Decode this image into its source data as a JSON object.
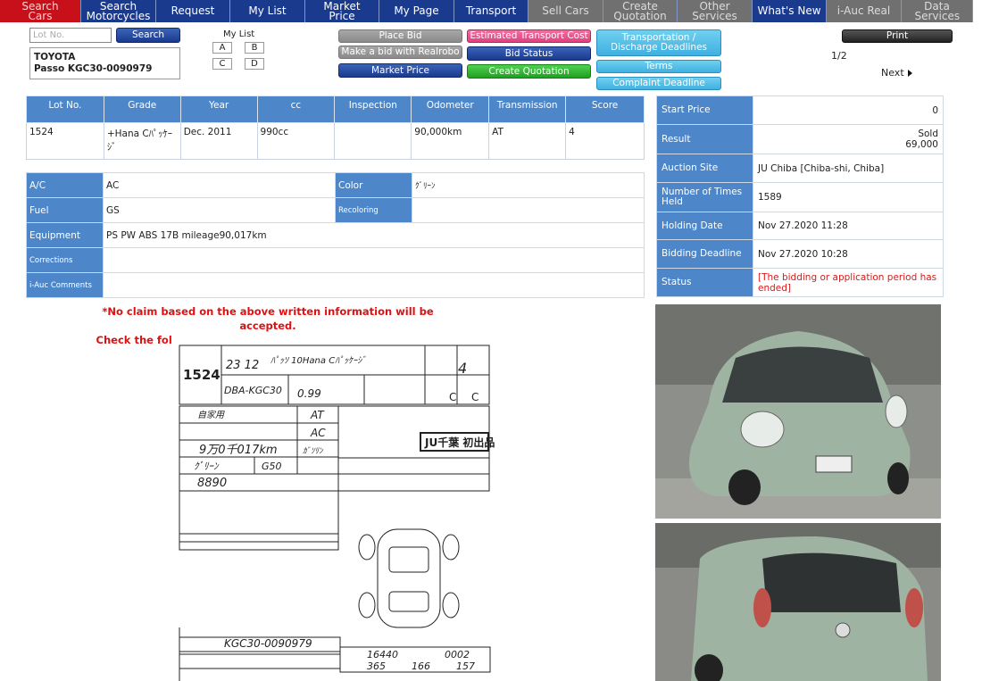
{
  "nav": {
    "items": [
      {
        "label": "Search Cars",
        "style": "active"
      },
      {
        "label": "Search Motorcycles",
        "style": "normal"
      },
      {
        "label": "Request",
        "style": "normal"
      },
      {
        "label": "My List",
        "style": "normal"
      },
      {
        "label": "Market Price",
        "style": "normal"
      },
      {
        "label": "My Page",
        "style": "normal"
      },
      {
        "label": "Transport",
        "style": "normal"
      },
      {
        "label": "Sell Cars",
        "style": "gray"
      },
      {
        "label": "Create Quotation",
        "style": "gray"
      },
      {
        "label": "Other Services",
        "style": "gray"
      },
      {
        "label": "What's New",
        "style": "normal"
      },
      {
        "label": "i-Auc Real",
        "style": "gray"
      },
      {
        "label": "Data Services",
        "style": "gray"
      }
    ]
  },
  "toolbar": {
    "lot_placeholder": "Lot No.",
    "search_label": "Search",
    "mylist_label": "My List",
    "mylist_slots": [
      "A",
      "B",
      "C",
      "D"
    ],
    "place_bid": "Place Bid",
    "make_bid_realrobo": "Make a bid with Realrobo",
    "market_price": "Market Price",
    "estimated_transport": "Estimated Transport Cost",
    "bid_status": "Bid Status",
    "create_quotation": "Create Quotation",
    "transport_deadlines": "Transportation / Discharge Deadlines",
    "terms": "Terms",
    "complaint_deadline": "Complaint Deadline",
    "print": "Print",
    "page_count": "1/2",
    "next": "Next"
  },
  "vehicle": {
    "make": "TOYOTA",
    "model": "Passo KGC30-0090979"
  },
  "spec_table": {
    "headers": [
      "Lot No.",
      "Grade",
      "Year",
      "cc",
      "Inspection",
      "Odometer",
      "Transmission",
      "Score"
    ],
    "row": [
      "1524",
      "+Hana Cﾊﾟｯｹｰｼﾞ",
      "Dec. 2011",
      "990cc",
      "",
      "90,000km",
      "AT",
      "4"
    ]
  },
  "details": {
    "ac_label": "A/C",
    "ac_value": "AC",
    "color_label": "Color",
    "color_value": "ｸﾞﾘｰﾝ",
    "fuel_label": "Fuel",
    "fuel_value": "GS",
    "recoloring_label": "Recoloring",
    "recoloring_value": "",
    "equipment_label": "Equipment",
    "equipment_value": "PS PW ABS 17B  mileage90,017km",
    "corrections_label": "Corrections",
    "corrections_value": "",
    "comments_label": "i-Auc Comments",
    "comments_value": ""
  },
  "auction_info": {
    "start_price_label": "Start Price",
    "start_price": "0",
    "result_label": "Result",
    "result_status": "Sold",
    "result_price": "69,000",
    "site_label": "Auction Site",
    "site": "JU Chiba [Chiba-shi, Chiba]",
    "times_label": "Number of Times Held",
    "times": "1589",
    "holding_label": "Holding Date",
    "holding": "Nov 27.2020 11:28",
    "deadline_label": "Bidding Deadline",
    "deadline": "Nov 27.2020 10:28",
    "status_label": "Status",
    "status": "[The bidding or application period has ended]"
  },
  "warning": {
    "line1": "*No claim based on the above written information will be accepted.",
    "line2": "Check the following auction sheet carefully before bidding."
  },
  "sheet": {
    "lot": "1524",
    "year_handwritten": "23 12",
    "model_handwritten": "ﾊﾟｯｿ 10Hana Cﾊﾟｯｹｰｼﾞ",
    "type_handwritten": "DBA-KGC30",
    "cc_handwritten": "0.99",
    "score_handwritten": "4",
    "interior": "C",
    "exterior": "C",
    "shift": "AT",
    "ac": "AC",
    "fuel": "ｶﾞｿﾘﾝ",
    "mileage_handwritten": "9万0千017km",
    "color_handwritten": "ｸﾞﾘｰﾝ",
    "color_code": "G50",
    "number": "8890",
    "usage": "自家用",
    "stamp": "JU千葉 初出品",
    "chassis": "KGC30-0090979",
    "codes": "16440",
    "code2": "0002",
    "dim1": "365",
    "dim2": "166",
    "dim3": "157"
  },
  "colors": {
    "nav_blue": "#1a3a8e",
    "nav_red": "#c8101a",
    "header_blue": "#4e87c9",
    "warning_red": "#e01010",
    "car_green": "#9fb3a3"
  }
}
